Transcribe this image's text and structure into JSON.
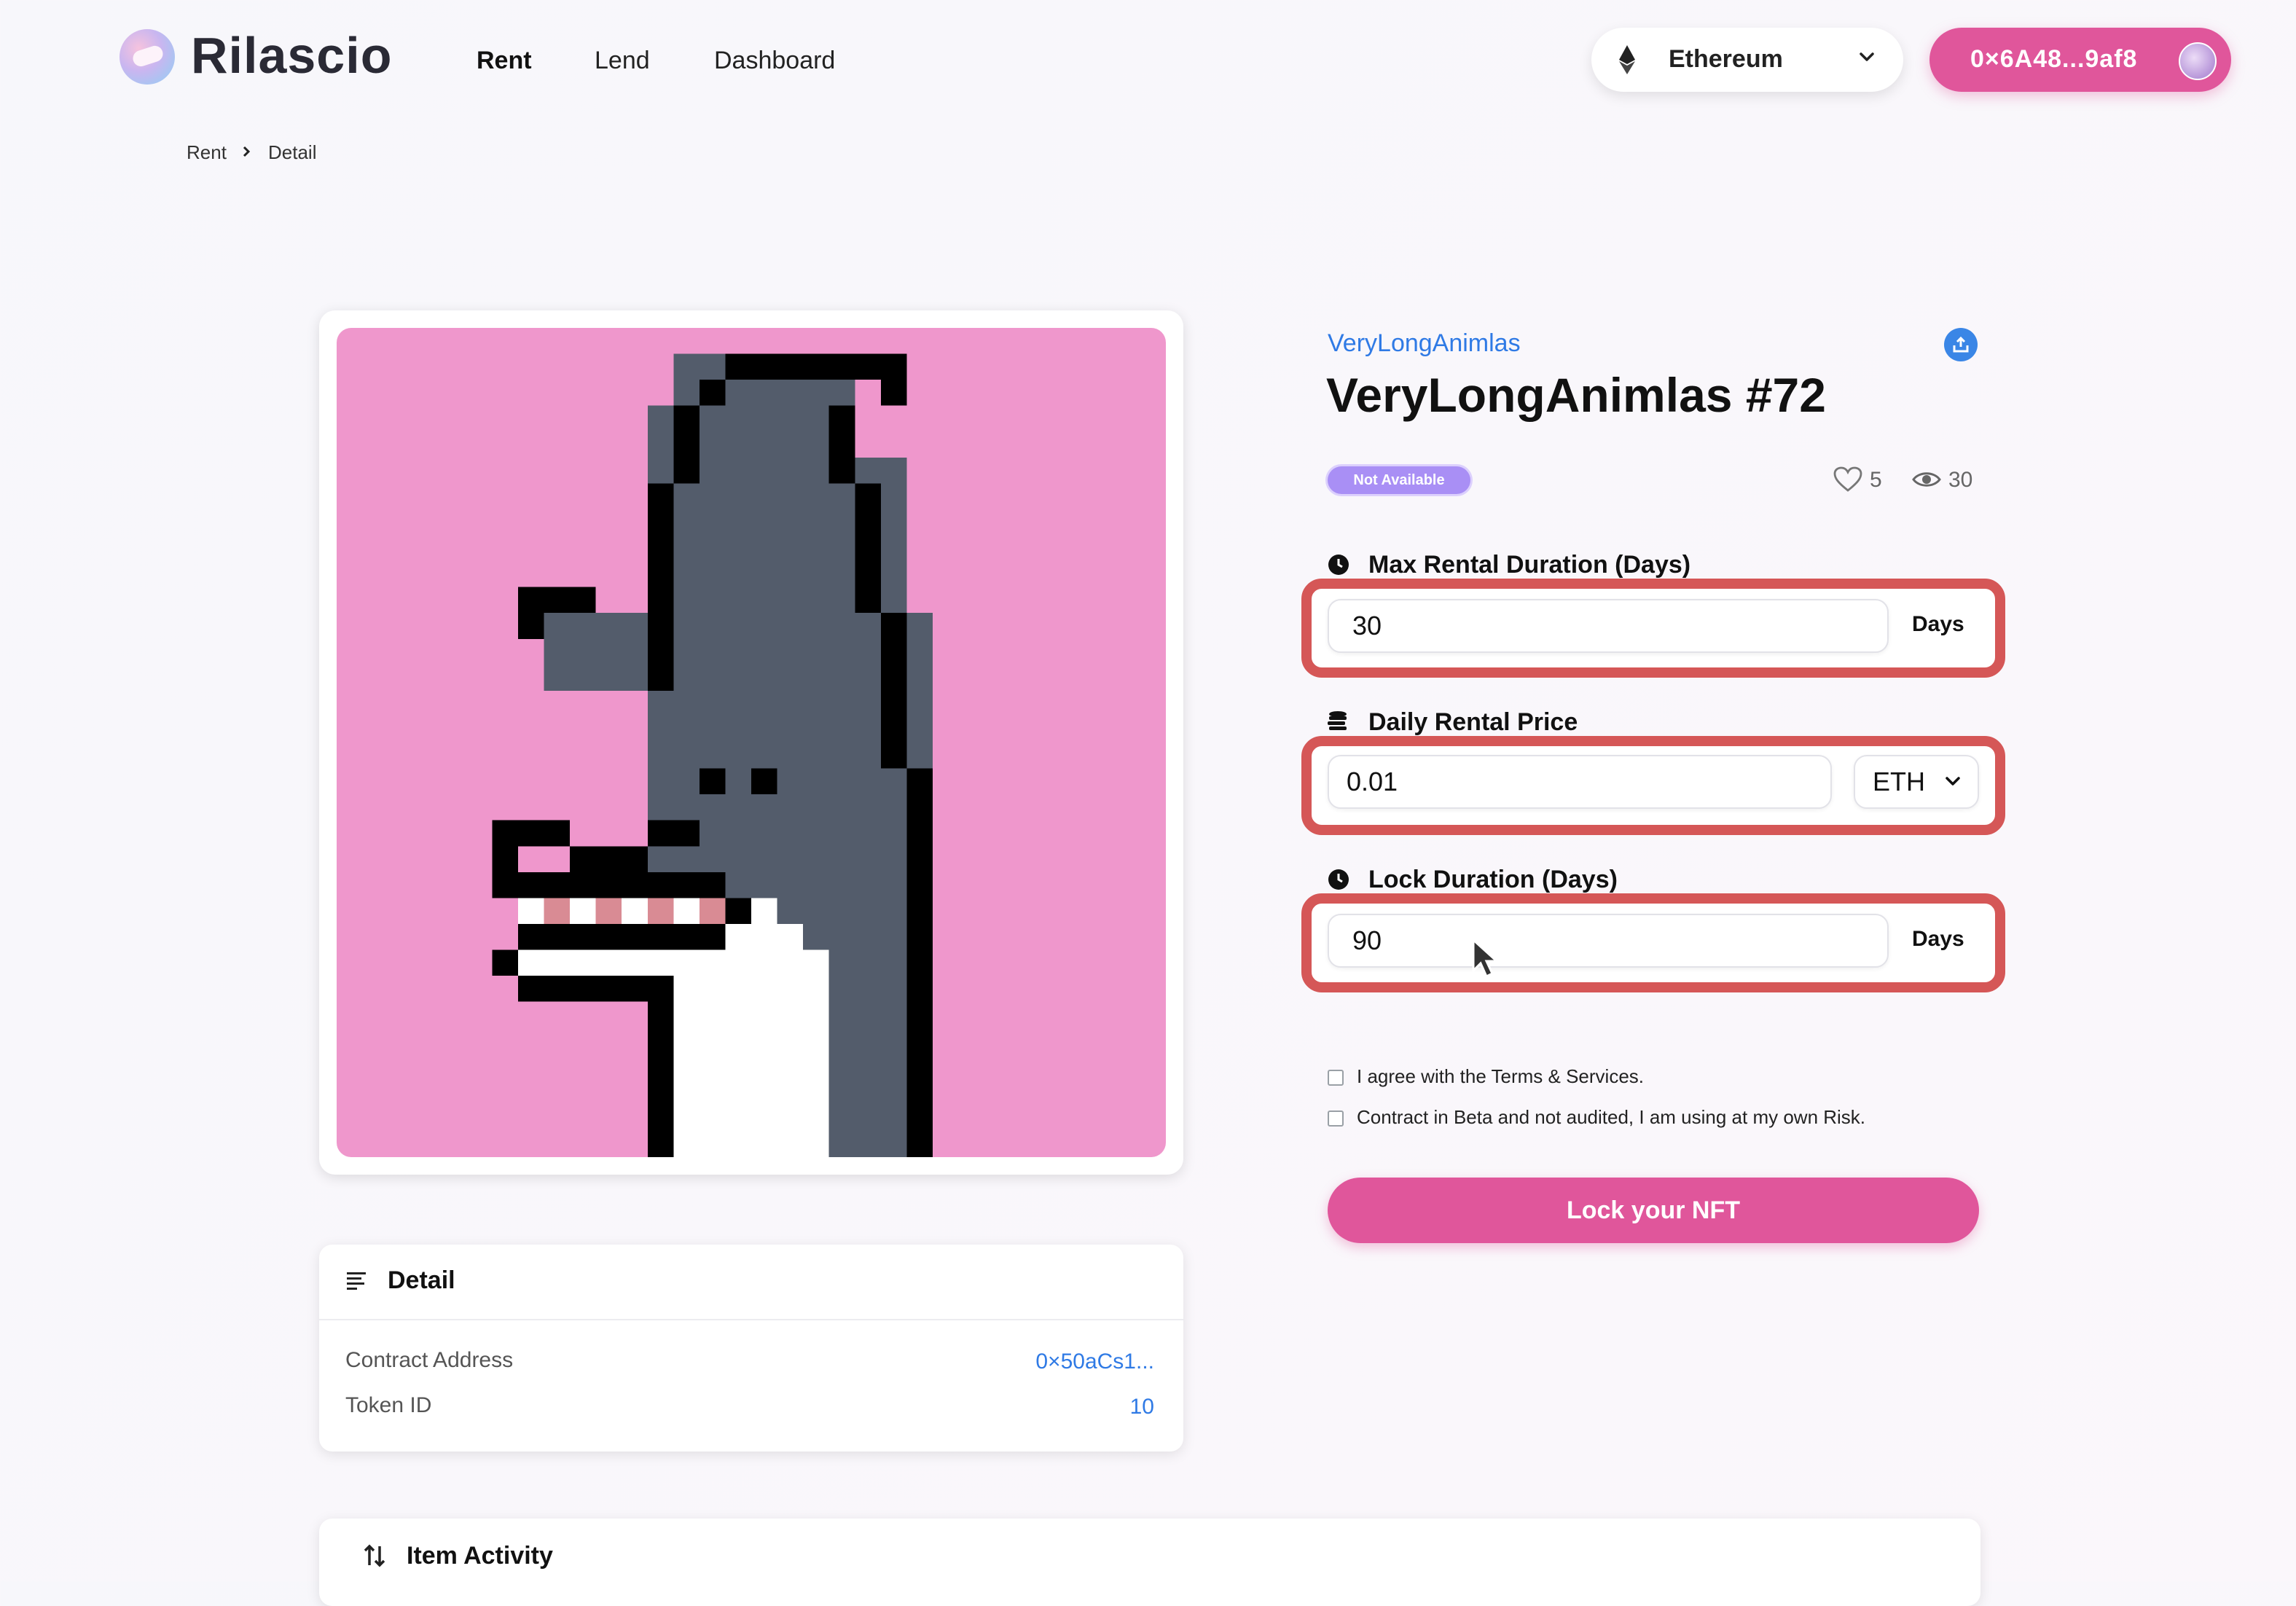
{
  "brand": {
    "name": "Rilascio"
  },
  "nav": {
    "rent": "Rent",
    "lend": "Lend",
    "dashboard": "Dashboard"
  },
  "network": {
    "label": "Ethereum",
    "icon": "ethereum-icon"
  },
  "wallet": {
    "address": "0×6A48...9af8"
  },
  "breadcrumb": {
    "root": "Rent",
    "current": "Detail"
  },
  "nft": {
    "collection": "VeryLongAnimlas",
    "title": "VeryLongAnimlas #72",
    "status": "Not Available",
    "likes": "5",
    "views": "30"
  },
  "form": {
    "max_duration": {
      "label": "Max Rental Duration (Days)",
      "value": "30",
      "unit": "Days"
    },
    "daily_price": {
      "label": "Daily Rental Price",
      "value": "0.01",
      "currency": "ETH"
    },
    "lock_duration": {
      "label": "Lock Duration (Days)",
      "value": "90",
      "unit": "Days"
    },
    "terms": "I agree with the Terms & Services.",
    "risk": "Contract in Beta and not audited, I am using at my own Risk.",
    "submit": "Lock your NFT"
  },
  "detail": {
    "title": "Detail",
    "rows": [
      {
        "label": "Contract Address",
        "value": "0×50aCs1..."
      },
      {
        "label": "Token ID",
        "value": "10"
      }
    ]
  },
  "activity": {
    "title": "Item Activity"
  },
  "colors": {
    "accent": "#e0569b",
    "link": "#2f7ae5",
    "highlight": "#d55757",
    "badge": "#a98ff5",
    "nft_bg": "#ef97cc"
  }
}
